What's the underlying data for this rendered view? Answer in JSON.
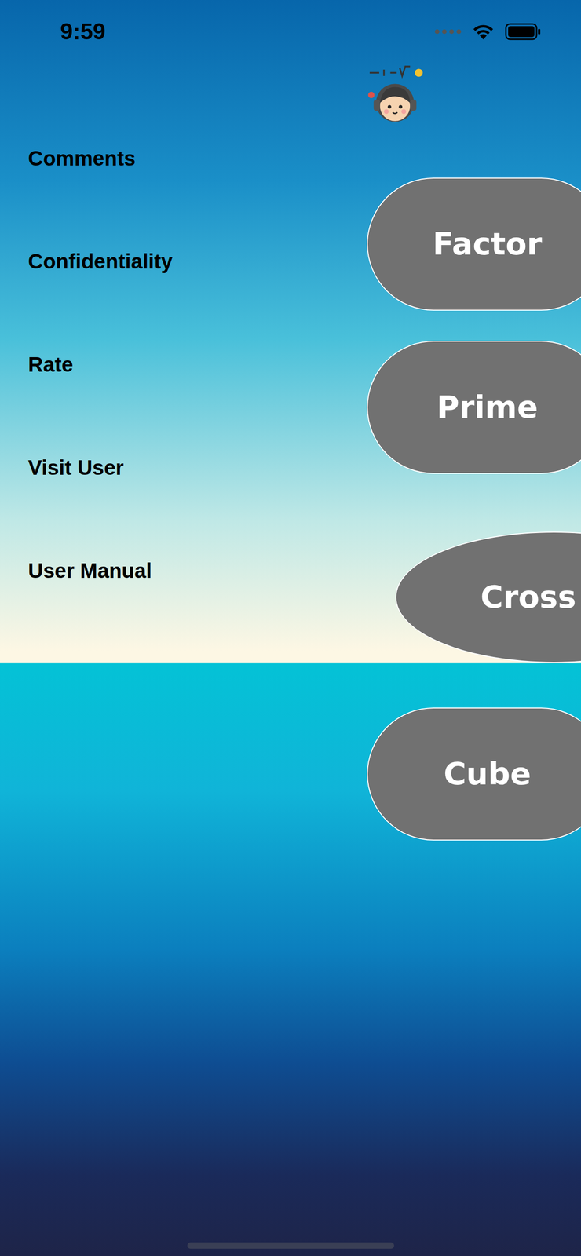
{
  "status_bar": {
    "time": "9:59"
  },
  "menu": {
    "items": [
      {
        "label": "Comments"
      },
      {
        "label": "Confidentiality"
      },
      {
        "label": "Rate"
      },
      {
        "label": "Visit User"
      },
      {
        "label": "User Manual"
      }
    ]
  },
  "buttons": [
    {
      "label": "Factor",
      "kind": "pill"
    },
    {
      "label": "Prime",
      "kind": "pill"
    },
    {
      "label": "Cross",
      "kind": "oval"
    },
    {
      "label": "Cube",
      "kind": "pill"
    }
  ]
}
